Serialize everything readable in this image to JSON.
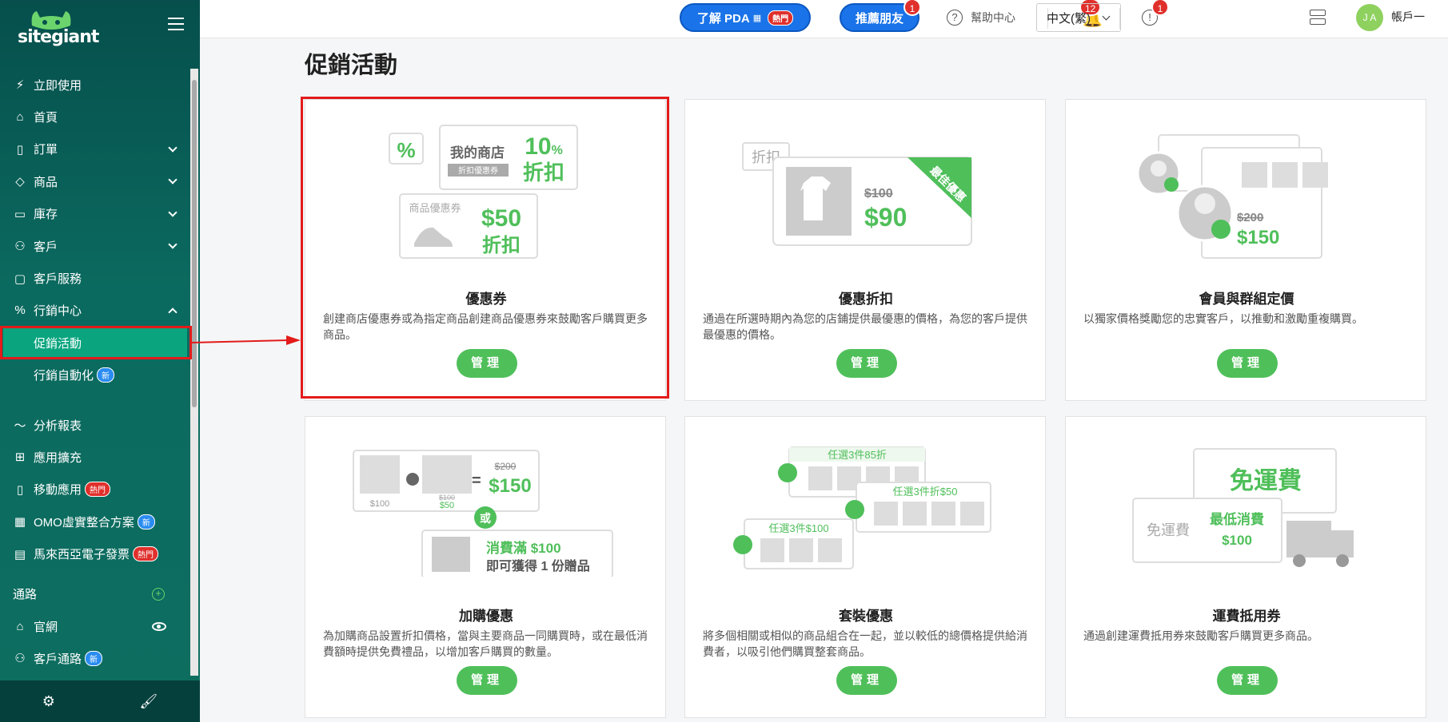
{
  "logo": {
    "brand": "sitegiant"
  },
  "sidebar": {
    "items": [
      {
        "label": "立即使用",
        "icon": "lightning-icon"
      },
      {
        "label": "首頁",
        "icon": "home-icon"
      },
      {
        "label": "訂單",
        "icon": "clipboard-icon"
      },
      {
        "label": "商品",
        "icon": "box-icon"
      },
      {
        "label": "庫存",
        "icon": "inventory-icon"
      },
      {
        "label": "客戶",
        "icon": "users-icon"
      },
      {
        "label": "客戶服務",
        "icon": "chat-icon"
      },
      {
        "label": "行銷中心",
        "icon": "percent-icon"
      },
      {
        "label": "促銷活動"
      },
      {
        "label": "行銷自動化",
        "badge": "新"
      },
      {
        "label": "分析報表",
        "icon": "pulse-icon"
      },
      {
        "label": "應用擴充",
        "icon": "grid-icon"
      },
      {
        "label": "移動應用",
        "icon": "mobile-icon",
        "badge": "熱門"
      },
      {
        "label": "OMO虛實整合方案",
        "icon": "store-icon",
        "badge": "新"
      },
      {
        "label": "馬來西亞電子發票",
        "icon": "invoice-icon",
        "badge": "熱門"
      }
    ],
    "channels_label": "通路",
    "channels": [
      {
        "label": "官網",
        "icon": "shop-icon"
      },
      {
        "label": "客戶通路",
        "icon": "people-icon",
        "badge": "新"
      }
    ]
  },
  "topbar": {
    "pda_label": "了解 PDA",
    "pda_badge": "熱門",
    "refer_label": "推薦朋友",
    "refer_count": "1",
    "help_label": "幫助中心",
    "bell_count": "12",
    "alert_count": "1",
    "language": "中文(繁)",
    "avatar_initials": "J A",
    "account_label": "帳戶一"
  },
  "page": {
    "title": "促銷活動"
  },
  "cards": [
    {
      "title": "優惠券",
      "desc": "創建商店優惠券或為指定商品創建商品優惠券來鼓勵客戶購買更多商品。",
      "button": "管理",
      "art": {
        "store": "我的商店",
        "store_tag": "折扣優惠券",
        "pct": "10",
        "pct_sign": "%",
        "off": "折扣",
        "coupon": "商品優惠券",
        "amount": "$50",
        "off2": "折扣",
        "percent_icon": "%"
      }
    },
    {
      "title": "優惠折扣",
      "desc": "通過在所選時期內為您的店鋪提供最優惠的價格，為您的客戶提供最優惠的價格。",
      "button": "管理",
      "art": {
        "tag": "折扣",
        "old": "$100",
        "new": "$90",
        "ribbon": "最佳優惠"
      }
    },
    {
      "title": "會員與群組定價",
      "desc": "以獨家價格獎勵您的忠實客戶，以推動和激勵重複購買。",
      "button": "管理",
      "art": {
        "old": "$200",
        "new": "$150"
      }
    },
    {
      "title": "加購優惠",
      "desc": "為加購商品設置折扣價格，當與主要商品一同購買時，或在最低消費額時提供免費禮品，以增加客戶購買的數量。",
      "button": "管理",
      "art": {
        "p1": "$100",
        "p2_old": "$100",
        "p2": "$50",
        "eq": "=",
        "old": "$200",
        "new": "$150",
        "or": "或",
        "spend": "消費滿 $100",
        "gift": "即可獲得 1 份贈品"
      }
    },
    {
      "title": "套裝優惠",
      "desc": "將多個相關或相似的商品組合在一起，並以較低的總價格提供給消費者，以吸引他們購買整套商品。",
      "button": "管理",
      "art": {
        "b1": "任選3件85折",
        "b2": "任選3件折$50",
        "b3": "任選3件$100"
      }
    },
    {
      "title": "運費抵用券",
      "desc": "通過創建運費抵用券來鼓勵客戶購買更多商品。",
      "button": "管理",
      "art": {
        "free": "免運費",
        "free2": "免運費",
        "min": "最低消費",
        "amt": "$100"
      }
    }
  ],
  "colors": {
    "sidebar": "#064f4c",
    "accent": "#4fbf5a",
    "primary": "#1a73e8",
    "highlight": "#e31b1b"
  }
}
